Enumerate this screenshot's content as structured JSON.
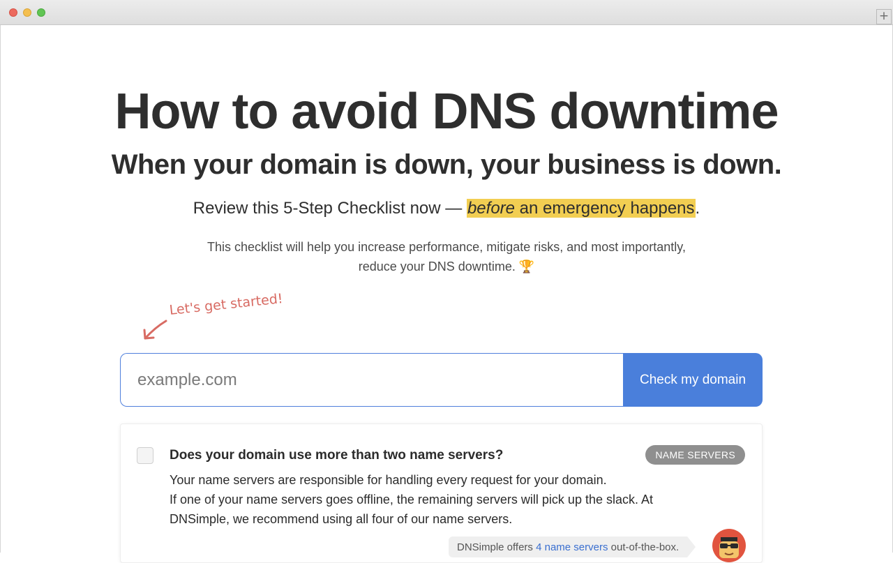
{
  "hero": {
    "title": "How to avoid DNS downtime",
    "subtitle": "When your domain is down, your business is down.",
    "lead_prefix": "Review this 5-Step Checklist now — ",
    "lead_highlight_em": "before",
    "lead_highlight_rest": " an emergency happens",
    "lead_suffix": ".",
    "intro_line1": "This checklist will help you increase performance, mitigate risks, and most importantly,",
    "intro_line2": "reduce your DNS downtime. 🏆"
  },
  "callout": {
    "text": "Let's get started!"
  },
  "domain_form": {
    "placeholder": "example.com",
    "value": "",
    "button_label": "Check my domain"
  },
  "checklist": [
    {
      "question": "Does your domain use more than two name servers?",
      "category": "NAME SERVERS",
      "checked": false,
      "answer_line1": "Your name servers are responsible for handling every request for your domain.",
      "answer_line2": "If one of your name servers goes offline, the remaining servers will pick up the slack. At DNSimple, we recommend using all four of our name servers.",
      "tip_prefix": "DNSimple offers ",
      "tip_link": "4 name servers",
      "tip_suffix": " out-of-the-box."
    }
  ],
  "colors": {
    "highlight": "#f2ce52",
    "primary": "#4a7fdb",
    "callout": "#d86b63",
    "badge": "#8f8f8f"
  },
  "icons": {
    "arrow": "curved-arrow-icon",
    "trophy": "trophy-icon",
    "mascot": "mascot-avatar"
  }
}
